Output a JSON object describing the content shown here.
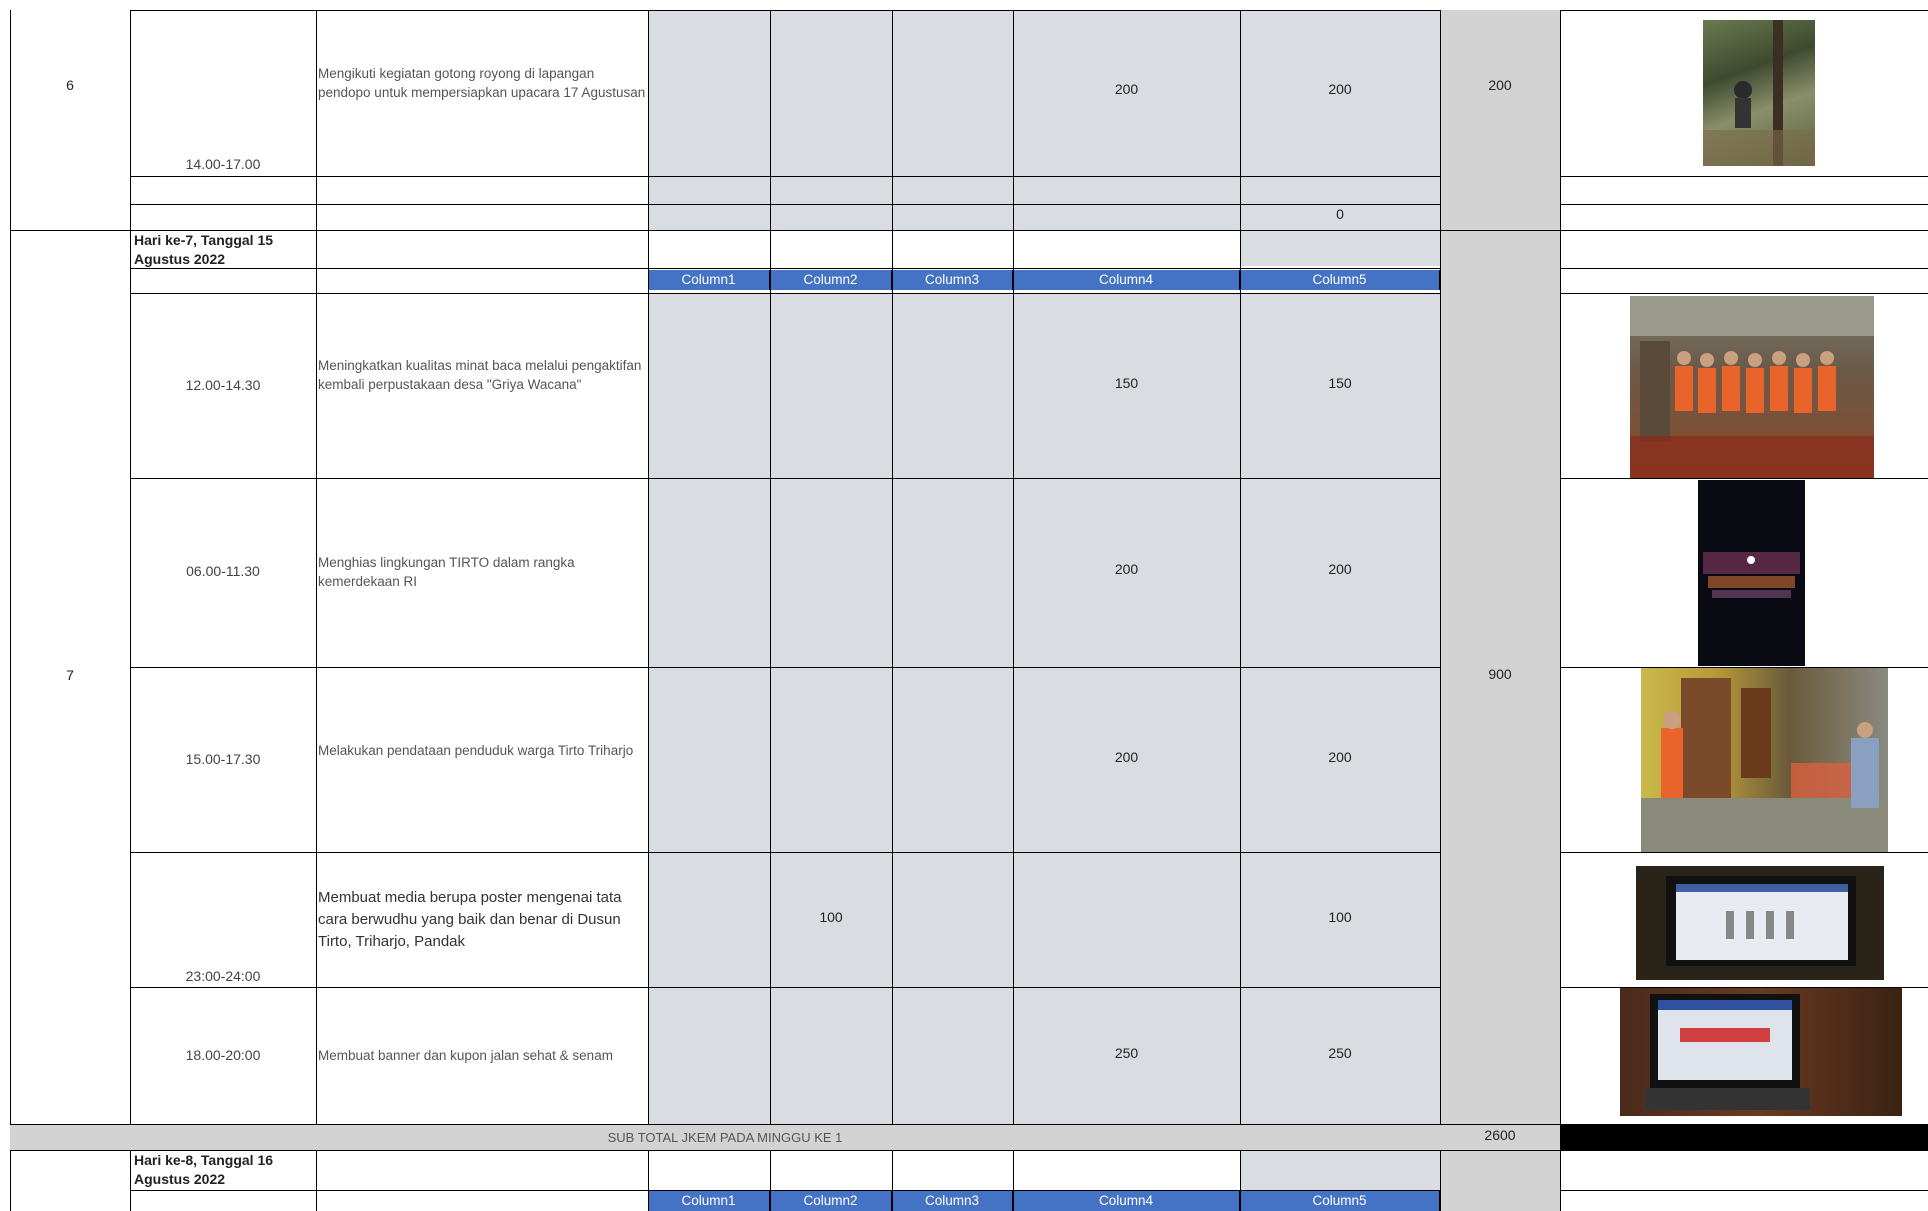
{
  "rows": {
    "r6": {
      "no": "6",
      "time": "14.00-17.00",
      "desc": "Mengikuti kegiatan gotong royong di lapangan pendopo untuk mempersiapkan upacara 17 Agustusan",
      "col4": "200",
      "col5": "200",
      "total": "200",
      "extra_zero": "0"
    },
    "day7": {
      "no": "7",
      "label": "Hari ke-7, Tanggal 15 Agustus 2022",
      "total": "900",
      "items": [
        {
          "time": "12.00-14.30",
          "desc": "Meningkatkan kualitas minat baca melalui pengaktifan kembali perpustakaan desa \"Griya Wacana\"",
          "col2": "",
          "col4": "150",
          "col5": "150"
        },
        {
          "time": "06.00-11.30",
          "desc": "Menghias lingkungan TIRTO dalam rangka kemerdekaan RI",
          "col2": "",
          "col4": "200",
          "col5": "200"
        },
        {
          "time": "15.00-17.30",
          "desc": "Melakukan pendataan penduduk warga Tirto Triharjo",
          "col2": "",
          "col4": "200",
          "col5": "200"
        },
        {
          "time": "23:00-24:00",
          "desc": "Membuat media berupa poster mengenai tata cara berwudhu yang baik dan benar di Dusun Tirto, Triharjo, Pandak",
          "col2": "100",
          "col4": "",
          "col5": "100"
        },
        {
          "time": "18.00-20:00",
          "desc": "Membuat banner dan kupon jalan sehat & senam",
          "col2": "",
          "col4": "250",
          "col5": "250"
        }
      ]
    },
    "subtotal": {
      "label": "SUB TOTAL JKEM PADA MINGGU KE 1",
      "value": "2600"
    },
    "day8": {
      "label": "Hari ke-8, Tanggal 16 Agustus 2022"
    }
  },
  "headers": [
    "Column1",
    "Column2",
    "Column3",
    "Column4",
    "Column5"
  ],
  "colors": {
    "header_blue": "#4472c4",
    "cell_gray": "#d9dce0",
    "total_gray": "#d3d3d3"
  }
}
